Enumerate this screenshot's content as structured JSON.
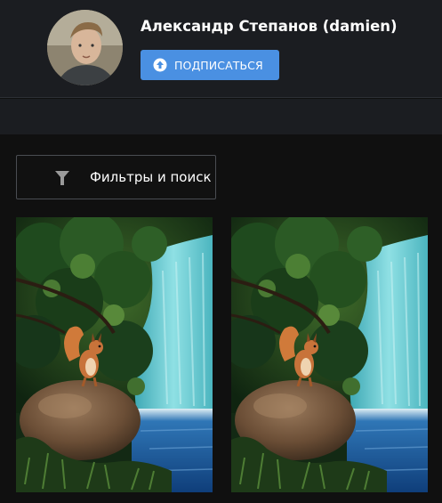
{
  "profile": {
    "name": "Александр Степанов (damien)",
    "subscribe_label": "ПОДПИСАТЬСЯ",
    "subscribe_icon": "arrow-up-circle-icon",
    "accent_color": "#4a90e2"
  },
  "filters": {
    "label": "Фильтры и поиск",
    "icon": "funnel-icon"
  },
  "gallery": {
    "items": [
      {
        "subject": "squirrel-on-rock-waterfall"
      },
      {
        "subject": "squirrel-on-rock-waterfall"
      }
    ]
  }
}
